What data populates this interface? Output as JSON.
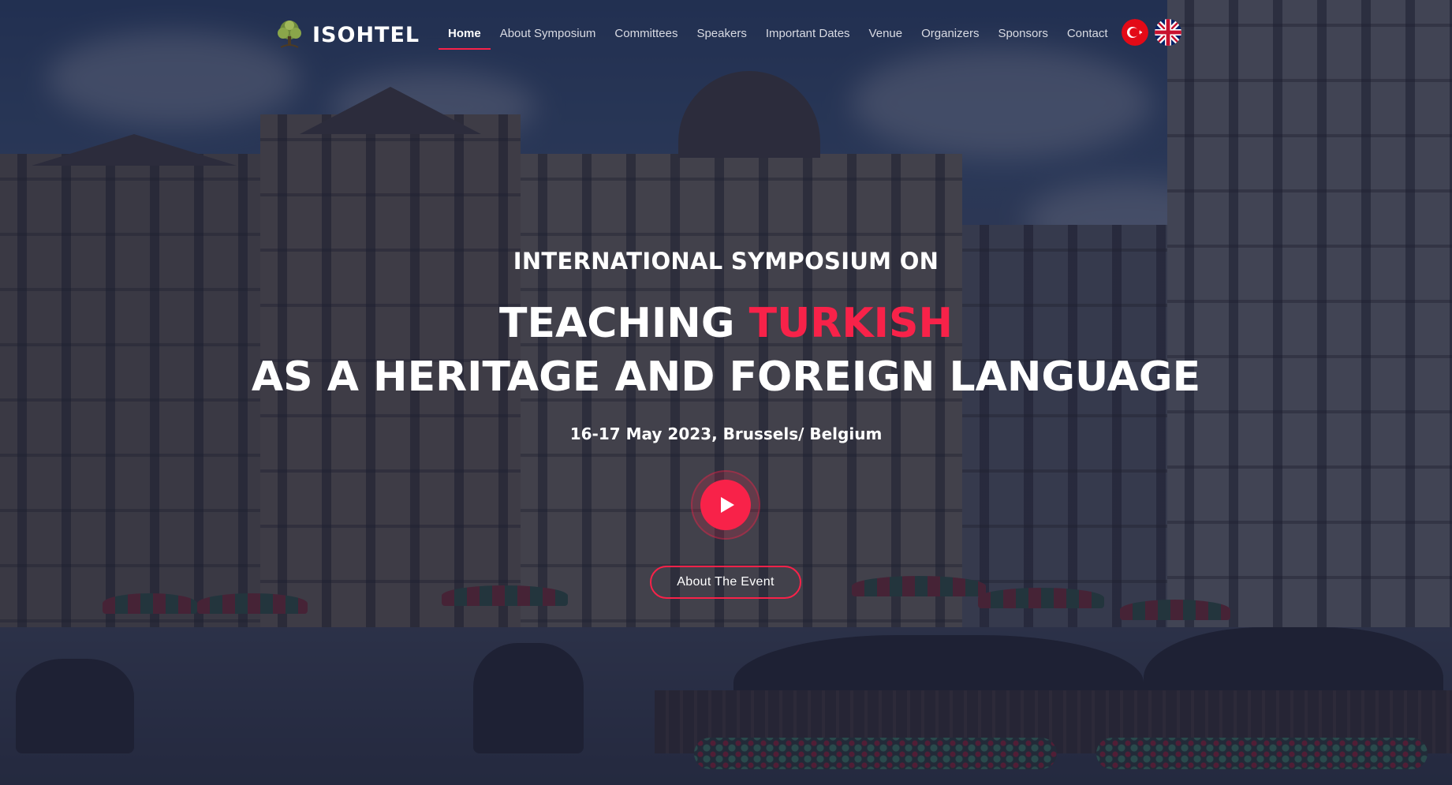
{
  "brand": {
    "name": "ISOHTEL",
    "logo_icon": "tree-logo-icon"
  },
  "nav": {
    "items": [
      {
        "label": "Home",
        "active": true
      },
      {
        "label": "About Symposium",
        "active": false
      },
      {
        "label": "Committees",
        "active": false
      },
      {
        "label": "Speakers",
        "active": false
      },
      {
        "label": "Important Dates",
        "active": false
      },
      {
        "label": "Venue",
        "active": false
      },
      {
        "label": "Organizers",
        "active": false
      },
      {
        "label": "Sponsors",
        "active": false
      },
      {
        "label": "Contact",
        "active": false
      }
    ],
    "languages": [
      {
        "icon": "turkey-flag-icon"
      },
      {
        "icon": "uk-flag-icon"
      }
    ]
  },
  "hero": {
    "eyebrow": "INTERNATIONAL SYMPOSIUM ON",
    "title_line1_prefix": "TEACHING",
    "title_line1_accent": "TURKISH",
    "title_line2": "AS A HERITAGE AND FOREIGN LANGUAGE",
    "date_location": "16-17 May 2023, Brussels/ Belgium",
    "play_icon": "play-icon",
    "cta_label": "About The Event"
  },
  "colors": {
    "accent": "#f82249",
    "overlay": "#161c38",
    "text": "#ffffff",
    "nav_text": "#d9dbe3"
  }
}
